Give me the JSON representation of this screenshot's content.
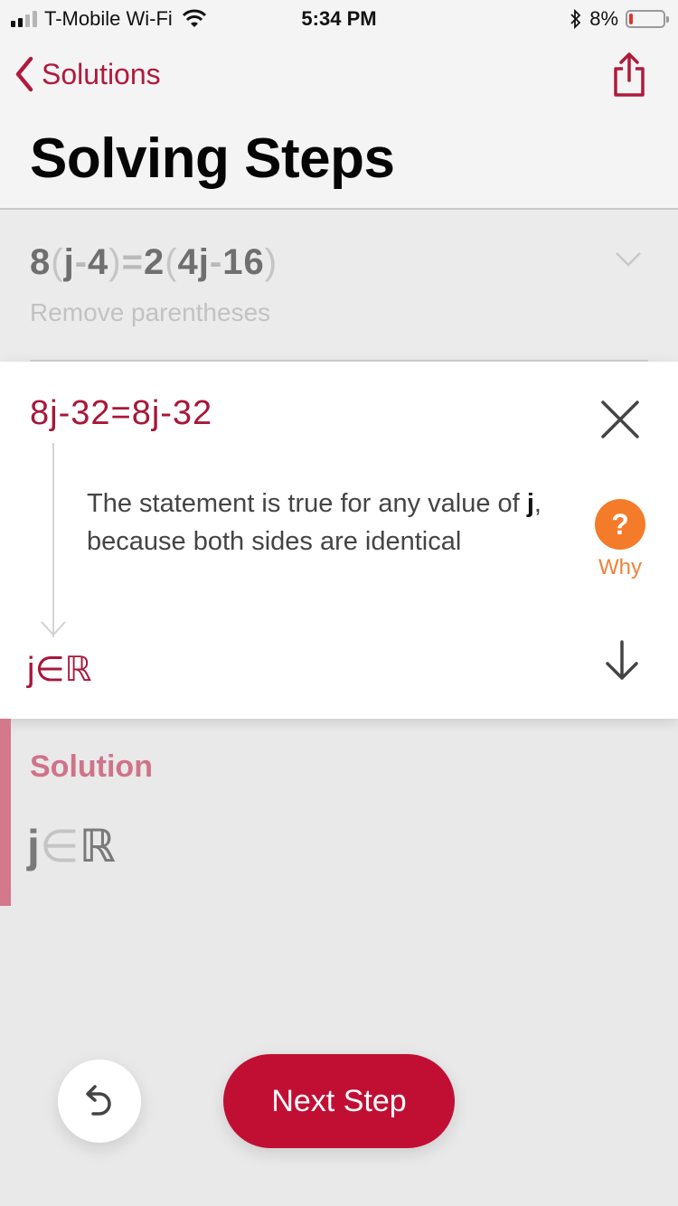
{
  "status_bar": {
    "carrier": "T-Mobile Wi-Fi",
    "time": "5:34 PM",
    "battery_percent": "8%",
    "battery_level": 0.08,
    "signal_bars_active": 2,
    "signal_bars_total": 4
  },
  "nav": {
    "back_label": "Solutions",
    "title": "Solving Steps"
  },
  "previous_step": {
    "equation": {
      "parts": [
        "8",
        "(",
        "j",
        "-",
        "4",
        ")",
        "=",
        "2",
        "(",
        "4j",
        "-",
        "16",
        ")"
      ]
    },
    "hint": "Remove parentheses"
  },
  "current_step": {
    "equation": "8j-32=8j-32",
    "explanation_before": "The statement is true for any value of ",
    "explanation_var": "j",
    "explanation_after": ", because both sides are identical",
    "why_label": "Why",
    "why_glyph": "?",
    "result": "j∈ℝ"
  },
  "solution": {
    "title": "Solution",
    "var": "j",
    "op": "∈",
    "set": "ℝ"
  },
  "actions": {
    "next_step_label": "Next Step"
  },
  "colors": {
    "accent": "#b01a3c",
    "button": "#c10f34",
    "why": "#f47b2a",
    "solution_bar": "#d4788c"
  }
}
